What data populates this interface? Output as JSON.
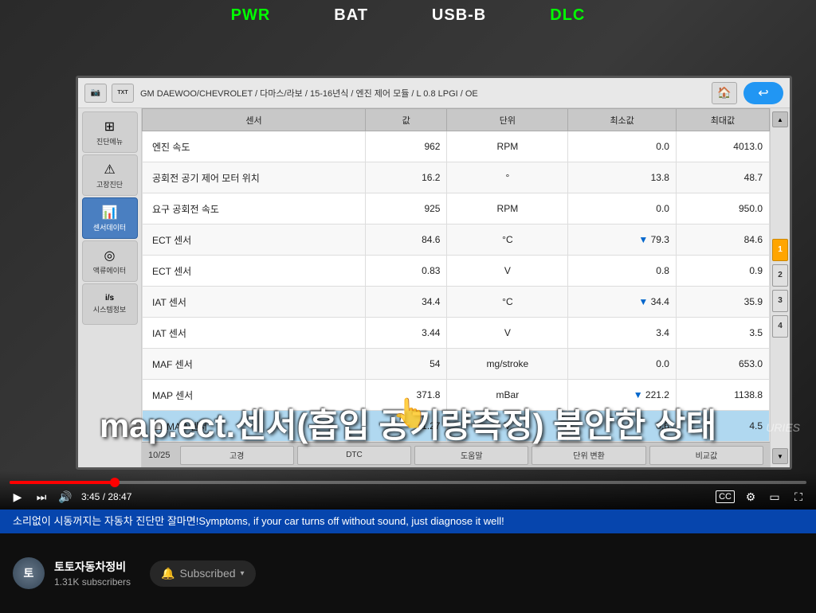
{
  "indicators": {
    "pwr": "PWR",
    "bat": "BAT",
    "usb": "USB-B",
    "dlc": "DLC"
  },
  "breadcrumb": {
    "path": "GM DAEWOO/CHEVROLET / 다마스/라보 / 15-16년식 / 엔진 제어 모듈 / L 0.8 LPGI / OE"
  },
  "table": {
    "headers": [
      "센서",
      "값",
      "단위",
      "최소값",
      "최대값"
    ],
    "rows": [
      {
        "name": "엔진 속도",
        "value": "962",
        "unit": "RPM",
        "min": "0.0",
        "max": "4013.0",
        "highlighted": false
      },
      {
        "name": "공회전 공기 제어 모터 위치",
        "value": "16.2",
        "unit": "°",
        "min": "13.8",
        "max": "48.7",
        "highlighted": false
      },
      {
        "name": "요구 공회전 속도",
        "value": "925",
        "unit": "RPM",
        "min": "0.0",
        "max": "950.0",
        "highlighted": false
      },
      {
        "name": "ECT 센서",
        "value": "84.6",
        "unit": "°C",
        "min": "▼ 79.3",
        "max": "84.6",
        "highlighted": false
      },
      {
        "name": "ECT 센서",
        "value": "0.83",
        "unit": "V",
        "min": "0.8",
        "max": "0.9",
        "highlighted": false
      },
      {
        "name": "IAT 센서",
        "value": "34.4",
        "unit": "°C",
        "min": "▼ 34.4",
        "max": "35.9",
        "highlighted": false
      },
      {
        "name": "IAT 센서",
        "value": "3.44",
        "unit": "V",
        "min": "3.4",
        "max": "3.5",
        "highlighted": false
      },
      {
        "name": "MAF 센서",
        "value": "54",
        "unit": "mg/stroke",
        "min": "0.0",
        "max": "653.0",
        "highlighted": false
      },
      {
        "name": "MAP 센서",
        "value": "371.8",
        "unit": "mBar",
        "min": "▼ 221.2",
        "max": "1138.8",
        "highlighted": false
      },
      {
        "name": "MAP 센서",
        "value": "1.27",
        "unit": "V",
        "min": "0.6",
        "max": "4.5",
        "highlighted": true
      }
    ]
  },
  "sidebar": {
    "items": [
      {
        "icon": "⊞",
        "label": "진단메뉴"
      },
      {
        "icon": "⚠",
        "label": "고장진단"
      },
      {
        "icon": "📊",
        "label": "센서데이터",
        "active": true
      },
      {
        "icon": "◎",
        "label": "액류에이터"
      },
      {
        "icon": "i/s",
        "label": "시스템정보"
      }
    ]
  },
  "bottom_bar": {
    "page": "10/25",
    "buttons": [
      "고경",
      "DTC",
      "도움말",
      "단위 변환",
      "비교값"
    ]
  },
  "scroll_numbers": [
    "1",
    "2",
    "3",
    "4"
  ],
  "subtitle": "map.ect.센서(흡입 공기량측정) 불안한 상태",
  "time": {
    "current": "3:45",
    "total": "28:47"
  },
  "caption": "소리없이 시동꺼지는 자동차 진단만 잘마면!Symptoms, if your car turns off without sound, just diagnose it well!",
  "channel": {
    "name": "토토자동차정비",
    "subscribers": "1.31K subscribers",
    "subscribed_label": "Subscribed",
    "avatar_letter": "토"
  },
  "controls": {
    "play_icon": "▶",
    "next_icon": "⏭",
    "volume_icon": "🔊",
    "cc_icon": "CC",
    "settings_icon": "⚙",
    "fullscreen_icon": "⛶",
    "theater_icon": "▭"
  },
  "watermark": "URIES"
}
